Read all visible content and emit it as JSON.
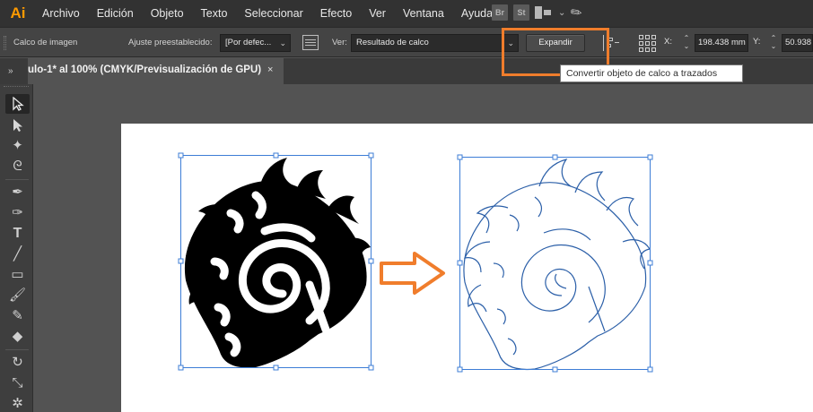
{
  "app": {
    "logo": "Ai",
    "brand_color": "#ff9a00"
  },
  "menu": [
    "Archivo",
    "Edición",
    "Objeto",
    "Texto",
    "Seleccionar",
    "Efecto",
    "Ver",
    "Ventana",
    "Ayuda"
  ],
  "app_icons": [
    "Br",
    "St"
  ],
  "control_bar": {
    "panel_title": "Calco de imagen",
    "preset_label": "Ajuste preestablecido:",
    "preset_value": "[Por defec...",
    "view_label": "Ver:",
    "view_value": "Resultado de calco",
    "expand_button": "Expandir",
    "x_label": "X:",
    "x_value": "198.438 mm",
    "y_label": "Y:",
    "y_value": "50.938"
  },
  "tooltip": "Convertir objeto de calco a trazados",
  "document_tab": {
    "title": "ulo-1* al 100% (CMYK/Previsualización de GPU)",
    "close": "×"
  },
  "highlight_color": "#f07d2c",
  "tools": [
    "selection-tool",
    "direct-selection-tool",
    "magic-wand-tool",
    "lasso-tool",
    "pen-tool",
    "curvature-tool",
    "type-tool",
    "line-tool",
    "rectangle-tool",
    "paintbrush-tool",
    "shaper-tool",
    "eraser-tool",
    "rotate-tool",
    "scale-tool",
    "warp-tool"
  ]
}
